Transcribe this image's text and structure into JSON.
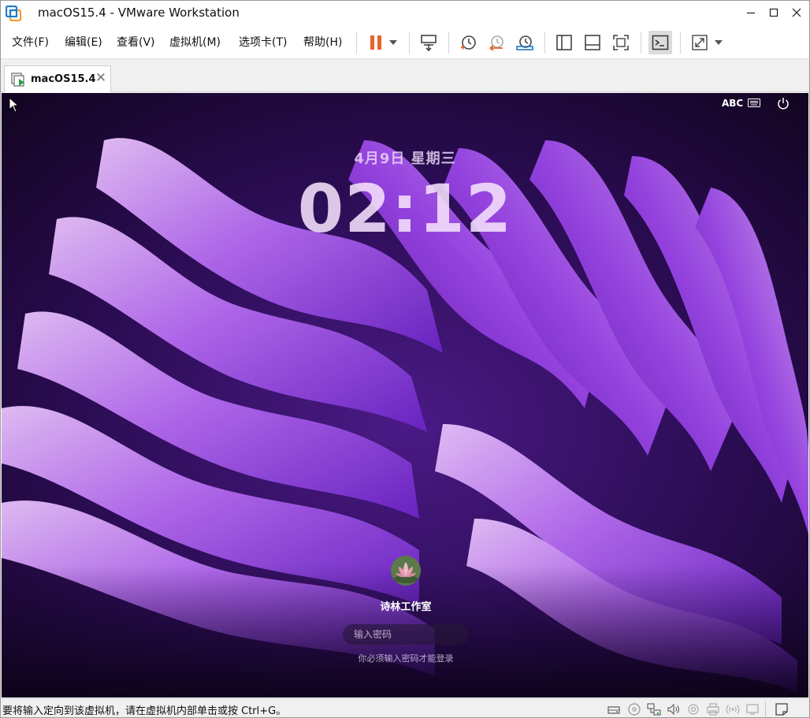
{
  "window": {
    "title": "macOS15.4 - VMware Workstation"
  },
  "menubar": {
    "items": [
      "文件(F)",
      "编辑(E)",
      "查看(V)",
      "虚拟机(M)",
      "选项卡(T)",
      "帮助(H)"
    ]
  },
  "toolbar": {
    "icons": [
      "pause-icon",
      "dropdown-arrow-icon",
      "send-keys-icon",
      "snapshot-icon",
      "revert-snapshot-icon",
      "snapshot-manager-icon",
      "library-icon",
      "thumbnail-icon",
      "fullscreen-fit-icon",
      "console-icon",
      "fullscreen-icon",
      "dropdown-arrow-icon"
    ],
    "pause_color": "#e8632b"
  },
  "tab": {
    "label": "macOS15.4",
    "close": "✕"
  },
  "vm_screen": {
    "input_source": "ABC",
    "date": "4月9日 星期三",
    "time": "02:12",
    "username": "诗林工作室",
    "password_placeholder": "输入密码",
    "hint": "你必须输入密码才能登录"
  },
  "statusbar": {
    "text": "要将输入定向到该虚拟机，请在虚拟机内部单击或按 Ctrl+G。",
    "icons": [
      "hard-disk-icon",
      "cd-dvd-icon",
      "network-icon",
      "sound-icon",
      "usb-icon",
      "printer-icon",
      "wireless-icon",
      "display-icon",
      "message-log-icon"
    ]
  },
  "colors": {
    "wallpaper_dark": "#1a0830",
    "wallpaper_mid": "#7a2fd0",
    "wallpaper_light": "#d9a6f5"
  }
}
